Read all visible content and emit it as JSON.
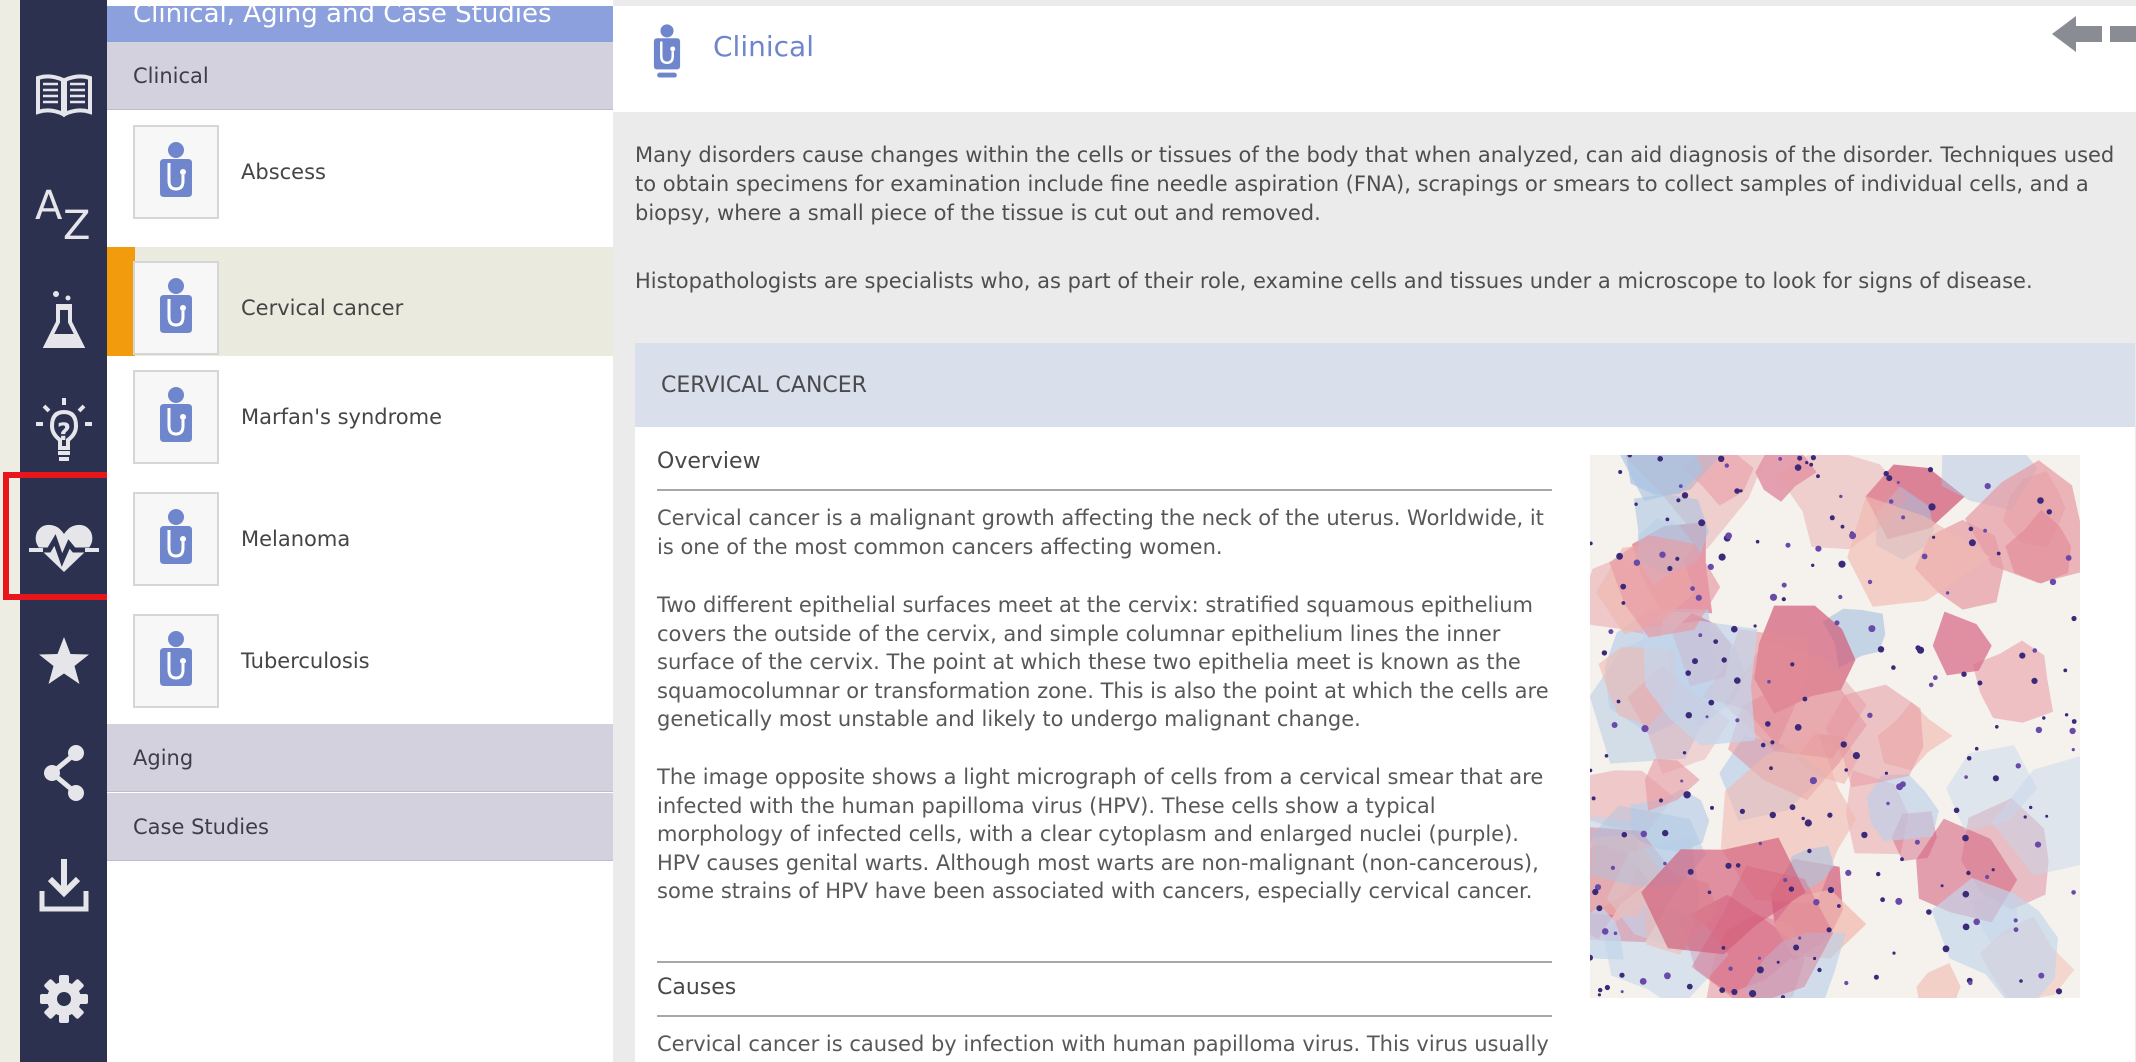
{
  "rail": {
    "items": [
      {
        "icon": "book-icon",
        "label": "Book"
      },
      {
        "icon": "a-z-index-icon",
        "label": "A–Z"
      },
      {
        "icon": "flask-icon",
        "label": "Lab"
      },
      {
        "icon": "idea-question-icon",
        "label": "Quiz"
      },
      {
        "icon": "heartbeat-icon",
        "label": "Clinical",
        "highlighted": true
      },
      {
        "icon": "star-icon",
        "label": "Favorites"
      },
      {
        "icon": "share-icon",
        "label": "Share"
      },
      {
        "icon": "download-icon",
        "label": "Download"
      },
      {
        "icon": "gear-icon",
        "label": "Settings"
      }
    ],
    "highlight_color": "#e8151b"
  },
  "topics": {
    "header": "Clinical, Aging and Case Studies",
    "categories": [
      "Clinical",
      "Aging",
      "Case Studies"
    ],
    "items": [
      {
        "label": "Abscess",
        "selected": false
      },
      {
        "label": "Cervical cancer",
        "selected": true
      },
      {
        "label": "Marfan's syndrome",
        "selected": false
      },
      {
        "label": "Melanoma",
        "selected": false
      },
      {
        "label": "Tuberculosis",
        "selected": false
      }
    ],
    "selected_accent": "#f29b0d"
  },
  "main": {
    "title": "Clinical",
    "intro": [
      "Many disorders cause changes within the cells or tissues of the body that when analyzed, can aid diagnosis of the disorder. Techniques used to obtain specimens for examination include fine needle aspiration (FNA), scrapings or smears to collect samples of individual cells, and a biopsy, where a small piece of the tissue is cut out and removed.",
      "Histopathologists are specialists who, as part of their role, examine cells and tissues under a microscope to look for signs of disease."
    ],
    "panel_title": "CERVICAL CANCER",
    "sections": {
      "overview_title": "Overview",
      "overview_paragraphs": [
        "Cervical cancer is a malignant growth affecting the neck of the uterus. Worldwide, it is one of the most common cancers affecting women.",
        "Two different epithelial surfaces meet at the cervix: stratified squamous epithelium covers the outside of the cervix, and simple columnar epithelium lines the inner surface of the cervix. The point at which these two epithelia meet is known as the squamocolumnar or transformation zone. This is also the point at which the cells are genetically most unstable and likely to undergo malignant change.",
        "The image opposite shows a light micrograph of cells from a cervical smear that are infected with the human papilloma virus (HPV). These cells show a typical morphology of infected cells, with a clear cytoplasm and enlarged nuclei (purple). HPV causes genital warts. Although most warts are non-malignant (non-cancerous), some strains of HPV have been associated with cancers, especially cervical cancer."
      ],
      "causes_title": "Causes",
      "causes_paragraph": "Cervical cancer is caused by infection with human papilloma virus. This virus usually"
    },
    "image": {
      "subject": "light micrograph of cervical smear cells"
    },
    "accent": "#6f86cc"
  }
}
